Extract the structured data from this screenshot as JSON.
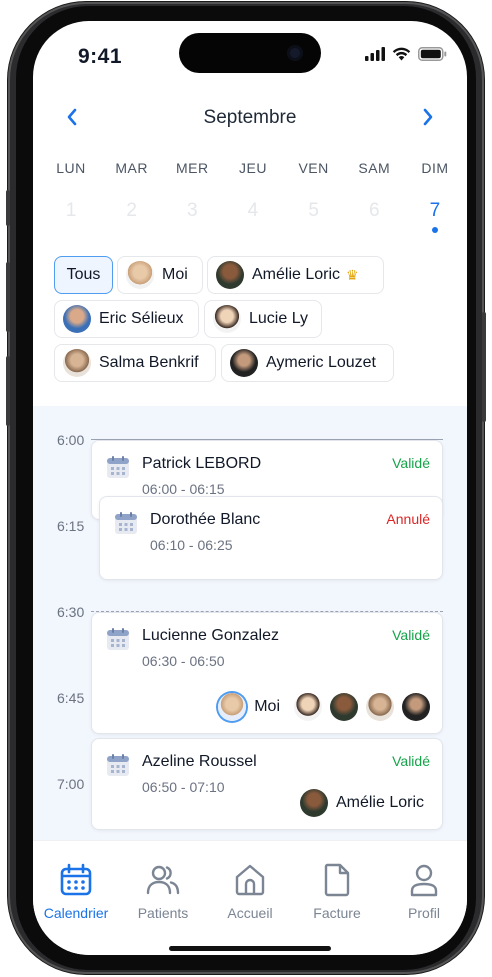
{
  "status_bar": {
    "time": "9:41"
  },
  "calendar": {
    "month": "Septembre",
    "prev_icon": "chevron-left-icon",
    "next_icon": "chevron-right-icon",
    "days": [
      {
        "name": "LUN",
        "num": "1"
      },
      {
        "name": "MAR",
        "num": "2"
      },
      {
        "name": "MER",
        "num": "3"
      },
      {
        "name": "JEU",
        "num": "4"
      },
      {
        "name": "VEN",
        "num": "5"
      },
      {
        "name": "SAM",
        "num": "6"
      },
      {
        "name": "DIM",
        "num": "7"
      }
    ],
    "selected_day": "7"
  },
  "filters": {
    "all_label": "Tous",
    "people": [
      {
        "label": "Moi"
      },
      {
        "label": "Amélie Loric",
        "badge": "crown-icon"
      },
      {
        "label": "Eric Sélieux"
      },
      {
        "label": "Lucie Ly"
      },
      {
        "label": "Salma Benkrif"
      },
      {
        "label": "Aymeric Louzet"
      }
    ]
  },
  "timeline": {
    "times": [
      "6:00",
      "6:15",
      "6:30",
      "6:45",
      "7:00"
    ],
    "appointments": [
      {
        "patient": "Patrick LEBORD",
        "range": "06:00 - 06:15",
        "status": "Validé"
      },
      {
        "patient": "Dorothée Blanc",
        "range": "06:10 - 06:25",
        "status": "Annulé"
      },
      {
        "patient": "Lucienne Gonzalez",
        "range": "06:30 - 06:50",
        "status": "Validé",
        "attendee_label": "Moi"
      },
      {
        "patient": "Azeline Roussel",
        "range": "06:50 - 07:10",
        "status": "Validé",
        "attendee_label": "Amélie Loric"
      }
    ]
  },
  "tabbar": {
    "items": [
      {
        "label": "Calendrier",
        "icon": "calendar-icon"
      },
      {
        "label": "Patients",
        "icon": "users-icon"
      },
      {
        "label": "Accueil",
        "icon": "home-icon"
      },
      {
        "label": "Facture",
        "icon": "document-icon"
      },
      {
        "label": "Profil",
        "icon": "profile-icon"
      }
    ],
    "active": "Calendrier"
  },
  "colors": {
    "accent": "#1a73e8",
    "validated": "#16a34a",
    "cancelled": "#dc2626",
    "timeline_bg": "#f2f7fd"
  }
}
